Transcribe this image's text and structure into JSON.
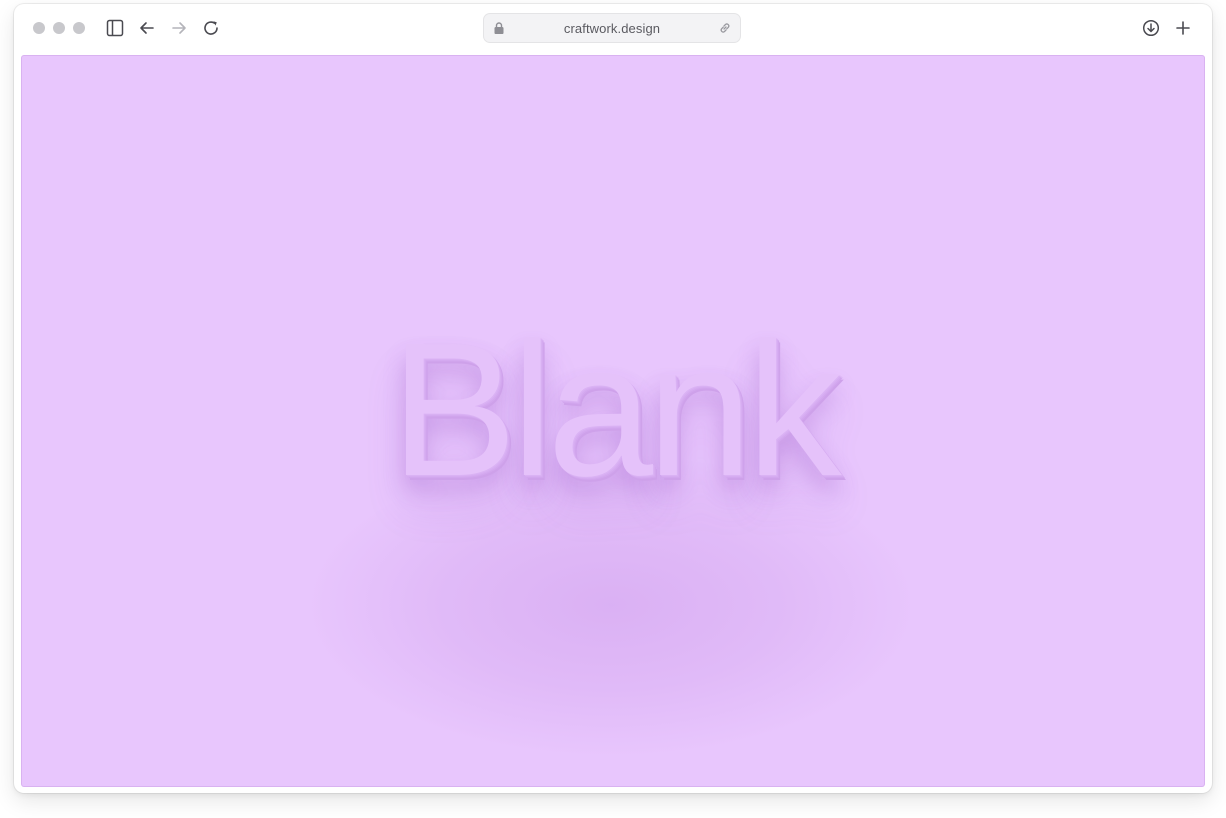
{
  "browser": {
    "url": "craftwork.design",
    "icons": {
      "traffic_lights": [
        "window-close",
        "window-minimize",
        "window-zoom"
      ],
      "toolbar_left": [
        "sidebar-icon",
        "back-arrow-icon",
        "forward-arrow-icon",
        "reload-icon"
      ],
      "address_bar": [
        "lock-icon",
        "link-icon"
      ],
      "toolbar_right": [
        "download-icon",
        "new-tab-plus-icon"
      ]
    }
  },
  "page": {
    "hero_text": "Blank",
    "background_color": "#e8c6fd",
    "text_color": "#e5c2fa"
  }
}
